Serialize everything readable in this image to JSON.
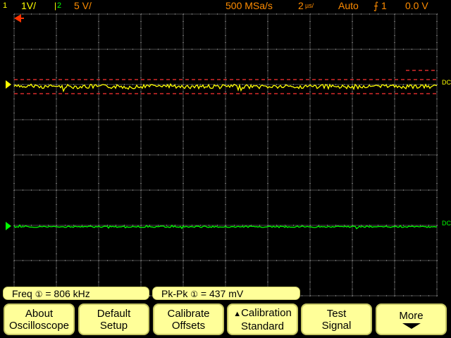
{
  "status_bar": {
    "channel1_index": "1",
    "channel1_scale": "1V/",
    "channel2_index": "2",
    "channel2_scale": "5 V/",
    "sample_rate": "500 MSa/s",
    "timebase": "2",
    "timebase_units": "µs/",
    "trigger_mode": "Auto",
    "trigger_source": "1",
    "trigger_level": "0.0 V"
  },
  "markers": {
    "channel1_label": "1",
    "channel2_label": "2",
    "channel1_coupling": "DC",
    "channel2_coupling": "DC"
  },
  "measurements": [
    {
      "label": "Freq",
      "channel": "1",
      "value": "= 806 kHz"
    },
    {
      "label": "Pk-Pk",
      "channel": "1",
      "value": "= 437 mV"
    }
  ],
  "softkeys": [
    {
      "line1": "About",
      "line2": "Oscilloscope"
    },
    {
      "line1": "Default",
      "line2": "Setup"
    },
    {
      "line1": "Calibrate",
      "line2": "Offsets"
    },
    {
      "line1": "Calibration",
      "line2": "Standard"
    },
    {
      "line1": "Test",
      "line2": "Signal"
    },
    {
      "line1": "More",
      "line2": ""
    }
  ],
  "colors": {
    "channel1": "#ffff00",
    "channel2": "#00ff00",
    "status_text": "#ff8c00",
    "grid": "#4a4a4a",
    "softkey_bg": "#ffff99",
    "cursor": "#ff3300"
  }
}
